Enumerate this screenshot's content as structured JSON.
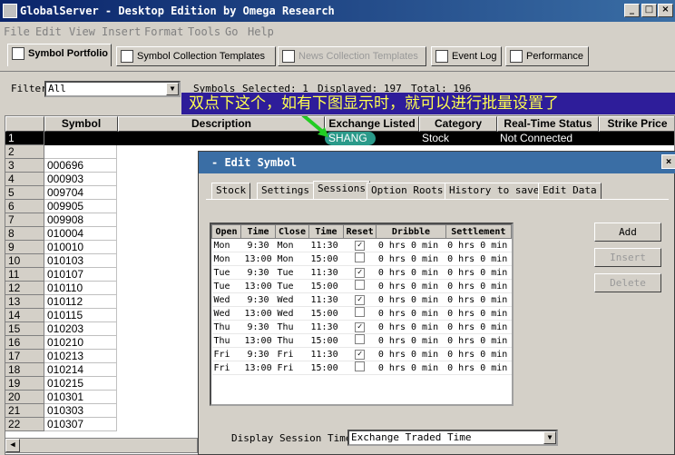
{
  "window": {
    "title": "GlobalServer - Desktop Edition by Omega Research"
  },
  "menu": [
    "File",
    "Edit",
    "View",
    "Insert",
    "Format",
    "Tools",
    "Go",
    "Help"
  ],
  "tabs": [
    {
      "label": "Symbol Portfolio"
    },
    {
      "label": "Symbol Collection Templates"
    },
    {
      "label": "News Collection Templates"
    },
    {
      "label": "Event Log"
    },
    {
      "label": "Performance"
    }
  ],
  "filter": {
    "label": "Filter",
    "value": "All",
    "symbols_label": "Symbols",
    "selected": "Selected: 1",
    "displayed": "Displayed: 197",
    "total": "Total: 196"
  },
  "banner": "双点下这个，如有下图显示时，就可以进行批量设置了",
  "grid": {
    "headers": [
      "Symbol",
      "Description",
      "Exchange Listed",
      "Category",
      "Real-Time Status",
      "Strike Price"
    ],
    "row1": {
      "num": "1",
      "exchange": "SHANG",
      "category": "Stock",
      "status": "Not Connected"
    },
    "rows": [
      [
        "2",
        ""
      ],
      [
        "3",
        "000696"
      ],
      [
        "4",
        "000903"
      ],
      [
        "5",
        "009704"
      ],
      [
        "6",
        "009905"
      ],
      [
        "7",
        "009908"
      ],
      [
        "8",
        "010004"
      ],
      [
        "9",
        "010010"
      ],
      [
        "10",
        "010103"
      ],
      [
        "11",
        "010107"
      ],
      [
        "12",
        "010110"
      ],
      [
        "13",
        "010112"
      ],
      [
        "14",
        "010115"
      ],
      [
        "15",
        "010203"
      ],
      [
        "16",
        "010210"
      ],
      [
        "17",
        "010213"
      ],
      [
        "18",
        "010214"
      ],
      [
        "19",
        "010215"
      ],
      [
        "20",
        "010301"
      ],
      [
        "21",
        "010303"
      ],
      [
        "22",
        "010307"
      ]
    ]
  },
  "dialog": {
    "title": "- Edit Symbol",
    "tabs": [
      "Stock",
      "Settings",
      "Sessions",
      "Option Roots",
      "History to save",
      "Edit Data"
    ],
    "cols": [
      "Open",
      "Time",
      "Close",
      "Time",
      "Reset",
      "Dribble",
      "Settlement"
    ],
    "rows": [
      [
        "Mon",
        "9:30",
        "Mon",
        "11:30",
        "check"
      ],
      [
        "Mon",
        "13:00",
        "Mon",
        "15:00",
        ""
      ],
      [
        "Tue",
        "9:30",
        "Tue",
        "11:30",
        "check"
      ],
      [
        "Tue",
        "13:00",
        "Tue",
        "15:00",
        ""
      ],
      [
        "Wed",
        "9:30",
        "Wed",
        "11:30",
        "check"
      ],
      [
        "Wed",
        "13:00",
        "Wed",
        "15:00",
        ""
      ],
      [
        "Thu",
        "9:30",
        "Thu",
        "11:30",
        "check"
      ],
      [
        "Thu",
        "13:00",
        "Thu",
        "15:00",
        ""
      ],
      [
        "Fri",
        "9:30",
        "Fri",
        "11:30",
        "check"
      ],
      [
        "Fri",
        "13:00",
        "Fri",
        "15:00",
        ""
      ]
    ],
    "dribble": "0 hrs 0 min",
    "settlement": "0 hrs 0 min",
    "buttons": {
      "add": "Add",
      "insert": "Insert",
      "delete": "Delete"
    },
    "display_label": "Display Session Times",
    "display_value": "Exchange Traded Time"
  }
}
